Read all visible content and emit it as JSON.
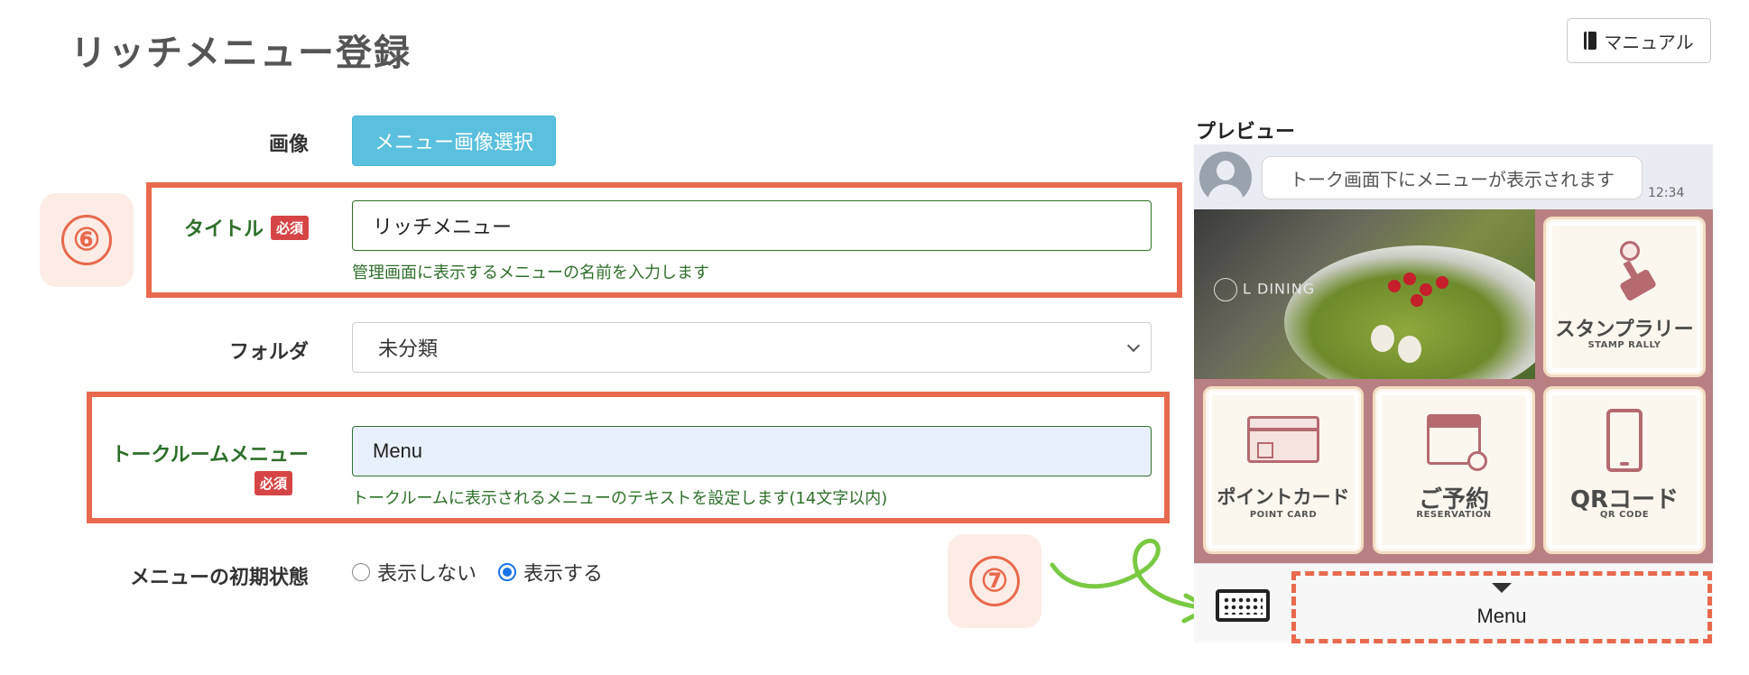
{
  "page": {
    "title": "リッチメニュー登録"
  },
  "header": {
    "manual_label": "マニュアル"
  },
  "form": {
    "image": {
      "label": "画像",
      "button_label": "メニュー画像選択"
    },
    "title": {
      "label": "タイトル",
      "required_badge": "必須",
      "value": "リッチメニュー",
      "help": "管理画面に表示するメニューの名前を入力します"
    },
    "folder": {
      "label": "フォルダ",
      "selected": "未分類"
    },
    "talkroom_menu": {
      "label": "トークルームメニュー",
      "required_badge": "必須",
      "value": "Menu",
      "help": "トークルームに表示されるメニューのテキストを設定します(14文字以内)"
    },
    "initial_state": {
      "label": "メニューの初期状態",
      "options": [
        {
          "label": "表示しない",
          "checked": false
        },
        {
          "label": "表示する",
          "checked": true
        }
      ]
    }
  },
  "steps": {
    "six": "⑥",
    "seven": "⑦"
  },
  "preview": {
    "label": "プレビュー",
    "chat_message": "トーク画面下にメニューが表示されます",
    "chat_time": "12:34",
    "photo_logo": "L DINING",
    "tiles": [
      {
        "title": "スタンプラリー",
        "subtitle": "STAMP RALLY"
      },
      {
        "title": "ポイントカード",
        "subtitle": "POINT CARD"
      },
      {
        "title": "ご予約",
        "subtitle": "RESERVATION"
      },
      {
        "title": "QRコード",
        "subtitle": "QR CODE"
      }
    ],
    "menu_bar_label": "Menu"
  },
  "colors": {
    "accent": "#e8694d",
    "label_green": "#2e6f2a",
    "button_blue": "#5bc0de",
    "required_red": "#d64545",
    "arrow_green": "#7ac943"
  }
}
